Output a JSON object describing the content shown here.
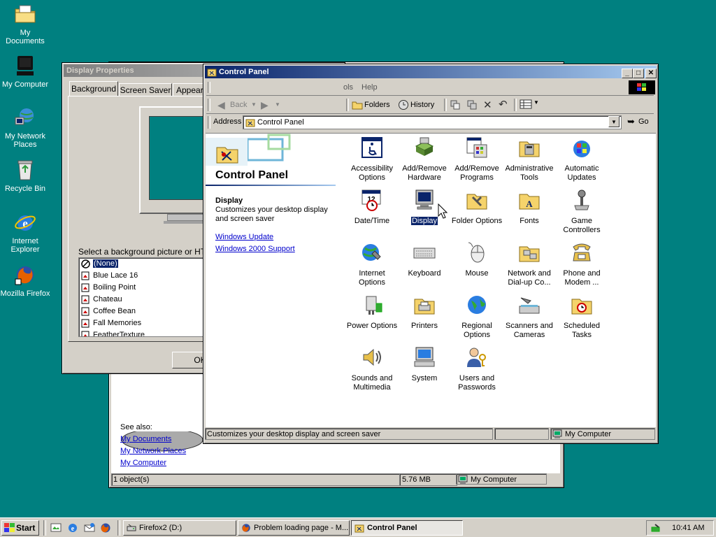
{
  "desktop": {
    "icons": [
      {
        "label": "My Documents",
        "icon": "my-documents-icon"
      },
      {
        "label": "My Computer",
        "icon": "my-computer-icon"
      },
      {
        "label": "My Network Places",
        "icon": "network-places-icon"
      },
      {
        "label": "Recycle Bin",
        "icon": "recycle-bin-icon"
      },
      {
        "label": "Internet Explorer",
        "icon": "internet-explorer-icon"
      },
      {
        "label": "Mozilla Firefox",
        "icon": "firefox-icon"
      }
    ]
  },
  "display_properties": {
    "title": "Display Properties",
    "tabs": [
      "Background",
      "Screen Saver",
      "Appeara"
    ],
    "prompt": "Select a background picture or HTML",
    "items": [
      "(None)",
      "Blue Lace 16",
      "Boiling Point",
      "Chateau",
      "Coffee Bean",
      "Fall Memories",
      "FeatherTexture"
    ],
    "ok_label": "OK"
  },
  "explorer_back": {
    "see_also": "See also:",
    "links": [
      "My Documents",
      "My Network Places",
      "My Computer"
    ],
    "status": {
      "objects": "1 object(s)",
      "size": "5.76 MB",
      "location": "My Computer"
    }
  },
  "control_panel": {
    "title": "Control Panel",
    "menu": {
      "partial": "ols",
      "help": "Help"
    },
    "toolbar": {
      "back": "Back",
      "folders": "Folders",
      "history": "History"
    },
    "address": {
      "label": "Address",
      "value": "Control Panel",
      "go": "Go"
    },
    "left": {
      "heading": "Control Panel",
      "sel_title": "Display",
      "sel_desc": "Customizes your desktop display and screen saver",
      "links": [
        "Windows Update",
        "Windows 2000 Support"
      ]
    },
    "items": [
      {
        "label": "Accessibility Options",
        "icon": "accessibility-icon"
      },
      {
        "label": "Add/Remove Hardware",
        "icon": "add-hardware-icon"
      },
      {
        "label": "Add/Remove Programs",
        "icon": "add-programs-icon"
      },
      {
        "label": "Administrative Tools",
        "icon": "admin-tools-icon"
      },
      {
        "label": "Automatic Updates",
        "icon": "windows-update-icon"
      },
      {
        "label": "Date/Time",
        "icon": "calendar-clock-icon"
      },
      {
        "label": "Display",
        "icon": "display-monitor-icon"
      },
      {
        "label": "Folder Options",
        "icon": "folder-options-icon"
      },
      {
        "label": "Fonts",
        "icon": "fonts-folder-icon"
      },
      {
        "label": "Game Controllers",
        "icon": "joystick-icon"
      },
      {
        "label": "Internet Options",
        "icon": "internet-globe-icon"
      },
      {
        "label": "Keyboard",
        "icon": "keyboard-icon"
      },
      {
        "label": "Mouse",
        "icon": "mouse-icon"
      },
      {
        "label": "Network and Dial-up Co...",
        "icon": "network-folder-icon"
      },
      {
        "label": "Phone and Modem ...",
        "icon": "phone-icon"
      },
      {
        "label": "Power Options",
        "icon": "power-plug-icon"
      },
      {
        "label": "Printers",
        "icon": "printer-folder-icon"
      },
      {
        "label": "Regional Options",
        "icon": "globe-icon"
      },
      {
        "label": "Scanners and Cameras",
        "icon": "scanner-icon"
      },
      {
        "label": "Scheduled Tasks",
        "icon": "scheduled-tasks-icon"
      },
      {
        "label": "Sounds and Multimedia",
        "icon": "speaker-icon"
      },
      {
        "label": "System",
        "icon": "computer-icon"
      },
      {
        "label": "Users and Passwords",
        "icon": "users-keys-icon"
      }
    ],
    "status": {
      "text": "Customizes your desktop display and screen saver",
      "zone": "My Computer"
    }
  },
  "taskbar": {
    "start": "Start",
    "tasks": [
      "Firefox2 (D:)",
      "Problem loading page - M...",
      "Control Panel"
    ],
    "clock": "10:41 AM"
  },
  "colors": {
    "desktop": "#008080",
    "title_active": "#0a246a",
    "face": "#d4d0c8"
  }
}
